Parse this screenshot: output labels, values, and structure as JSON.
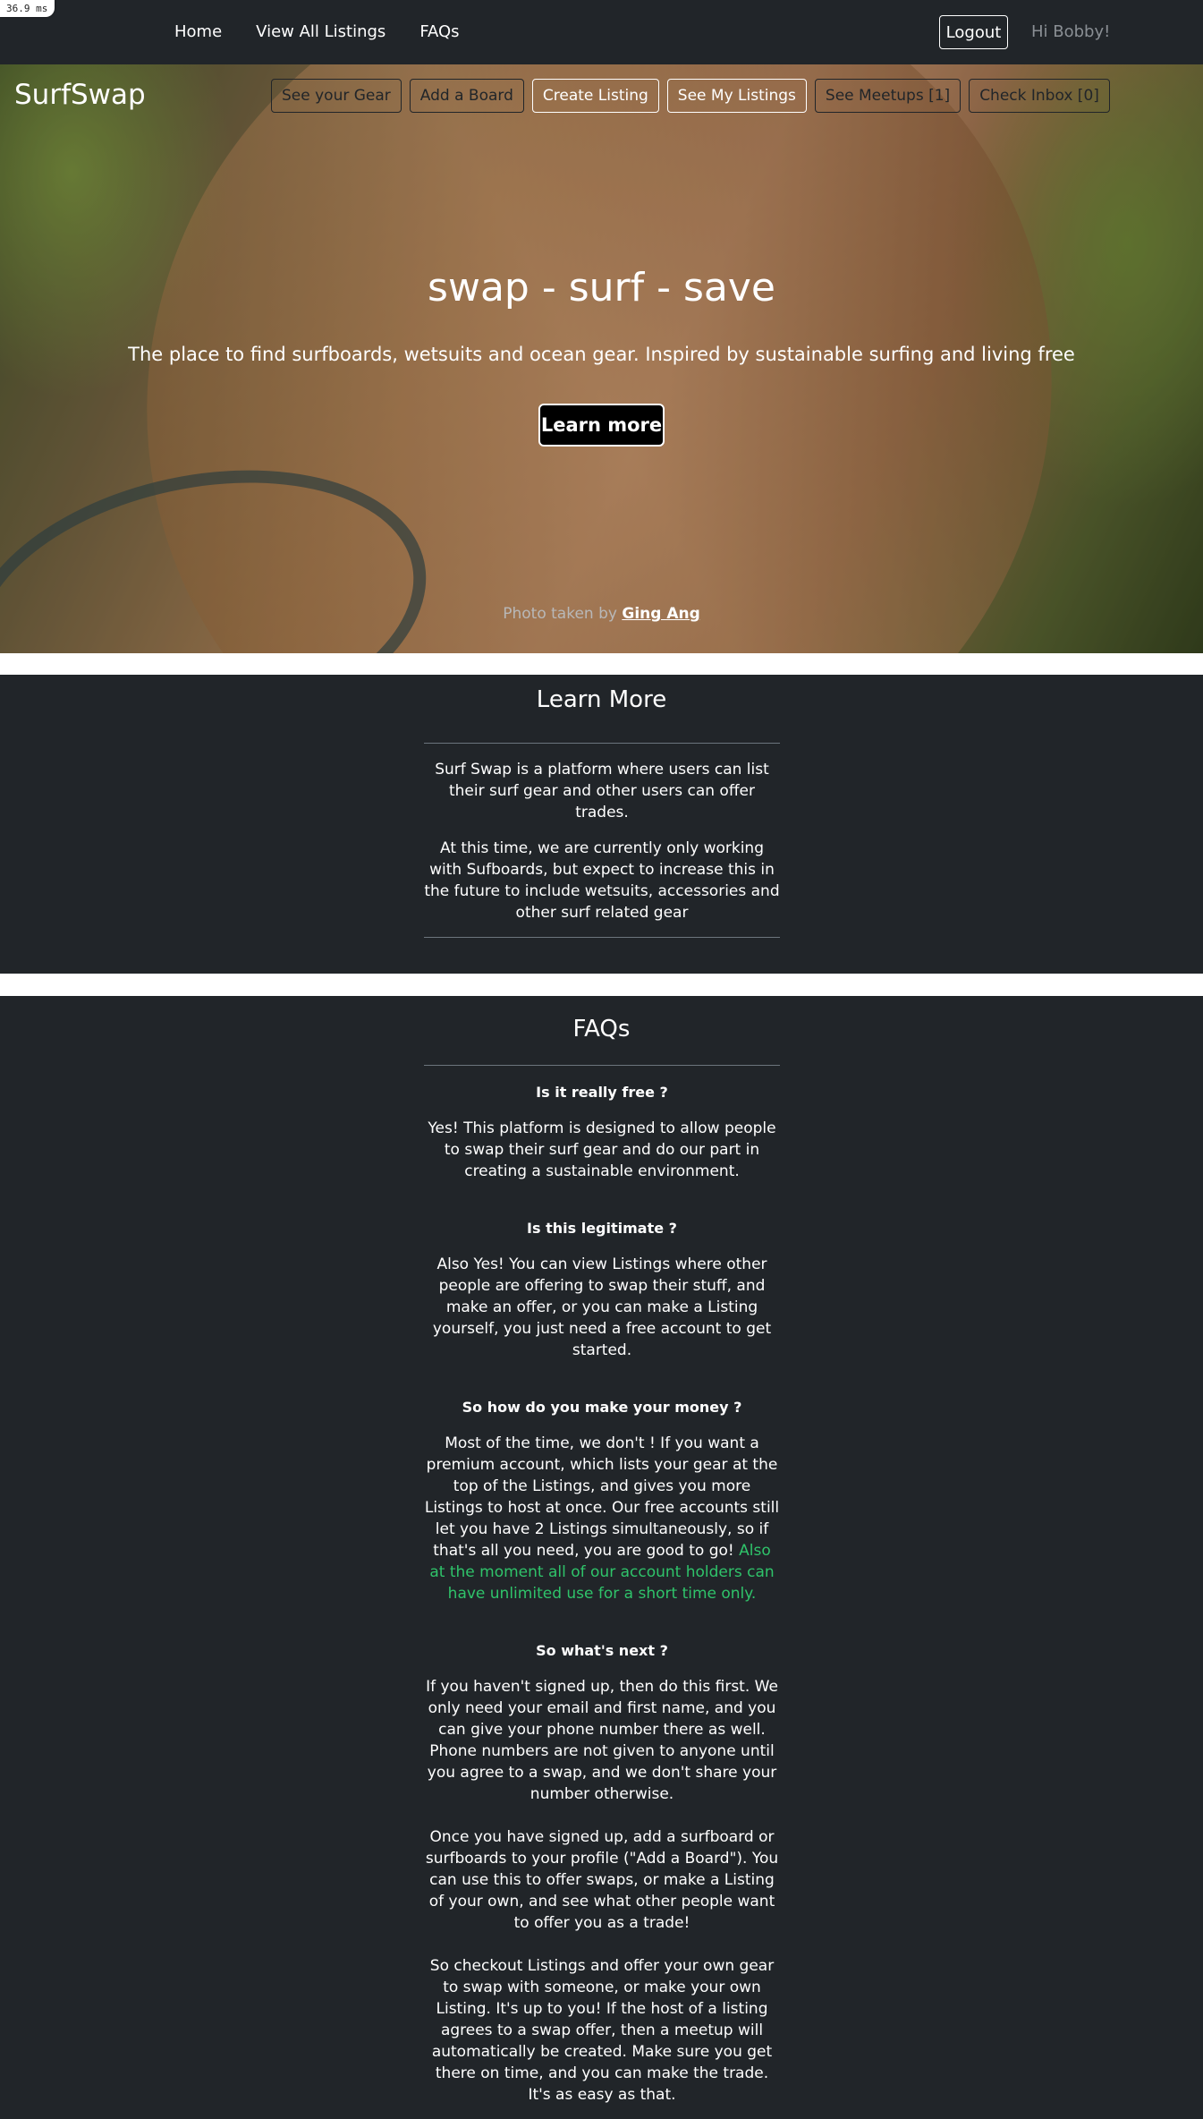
{
  "debug": {
    "timing": "36.9 ms"
  },
  "topnav": {
    "links": [
      "Home",
      "View All Listings",
      "FAQs"
    ],
    "logout_label": "Logout",
    "greeting": "Hi Bobby!"
  },
  "hero": {
    "brand": "SurfSwap",
    "actions": [
      "See your Gear",
      "Add a Board",
      "Create Listing",
      "See My Listings",
      "See Meetups [1]",
      "Check Inbox [0]"
    ],
    "title": "swap - surf - save",
    "subtitle": "The place to find surfboards, wetsuits and ocean gear. Inspired by sustainable surfing and living free",
    "cta_label": "Learn more",
    "credit_prefix": "Photo taken by",
    "credit_author": "Ging Ang"
  },
  "learn_more": {
    "heading": "Learn More",
    "paragraphs": [
      "Surf Swap is a platform where users can list their surf gear and other users can offer trades.",
      "At this time, we are currently only working with Sufboards, but expect to increase this in the future to include wetsuits, accessories and other surf related gear"
    ]
  },
  "faqs": {
    "heading": "FAQs",
    "items": [
      {
        "question": "Is it really free ?",
        "answer": "Yes! This platform is designed to allow people to swap their surf gear and do our part in creating a sustainable environment."
      },
      {
        "question": "Is this legitimate ?",
        "answer": "Also Yes! You can view Listings where other people are offering to swap their stuff, and make an offer, or you can make a Listing yourself, you just need a free account to get started."
      },
      {
        "question": "So how do you make your money ?",
        "answer": "Most of the time, we don't ! If you want a premium account, which lists your gear at the top of the Listings, and gives you more Listings to host at once. Our free accounts still let you have 2 Listings simultaneously, so if that's all you need, you are good to go!",
        "highlight": "Also at the moment all of our account holders can have unlimited use for a short time only."
      },
      {
        "question": "So what's next ?",
        "answer_parts": [
          "If you haven't signed up, then do this first. We only need your email and first name, and you can give your phone number there as well. Phone numbers are not given to anyone until you agree to a swap, and we don't share your number otherwise.",
          "Once you have signed up, add a surfboard or surfboards to your profile (\"Add a Board\"). You can use this to offer swaps, or make a Listing of your own, and see what other people want to offer you as a trade!",
          "So checkout Listings and offer your own gear to swap with someone, or make your own Listing. It's up to you! If the host of a listing agrees to a swap offer, then a meetup will automatically be created. Make sure you get there on time, and you can make the trade. It's as easy as that."
        ]
      }
    ]
  },
  "colors": {
    "dark": "#212529",
    "accent_green": "#2fc36a",
    "muted": "#8a8f94"
  }
}
